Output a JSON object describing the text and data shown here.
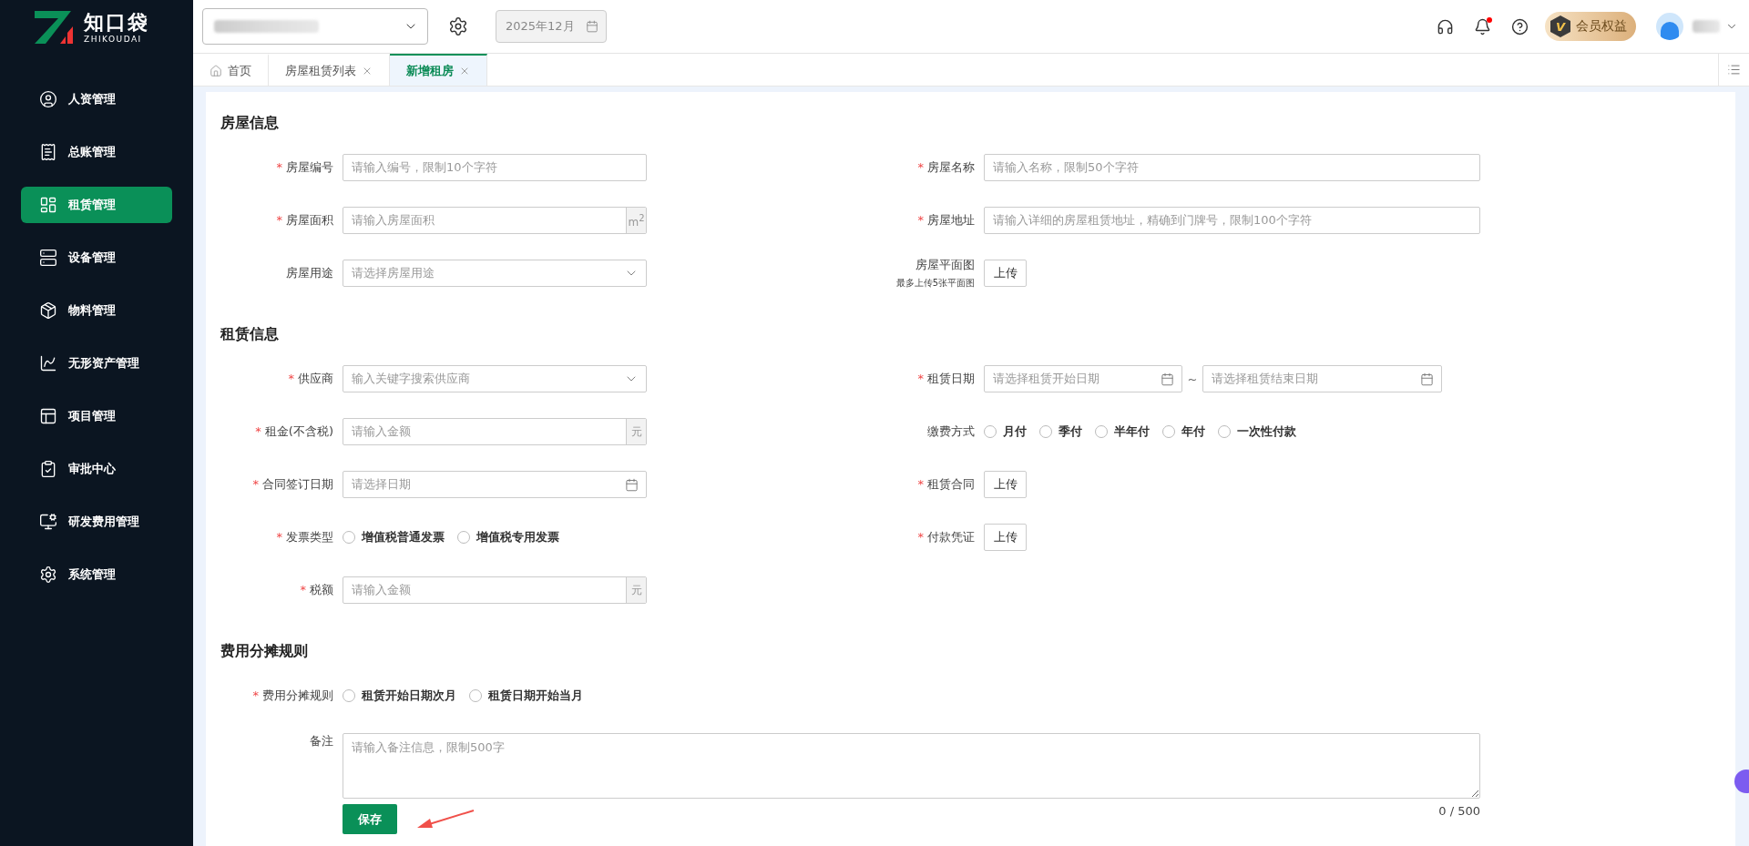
{
  "sidebar": {
    "logo": {
      "name": "知口袋",
      "subtitle": "ZHIKOUDAI"
    },
    "items": [
      {
        "label": "人资管理",
        "selected": false
      },
      {
        "label": "总账管理",
        "selected": false
      },
      {
        "label": "租赁管理",
        "selected": true
      },
      {
        "label": "设备管理",
        "selected": false
      },
      {
        "label": "物料管理",
        "selected": false
      },
      {
        "label": "无形资产管理",
        "selected": false
      },
      {
        "label": "项目管理",
        "selected": false
      },
      {
        "label": "审批中心",
        "selected": false
      },
      {
        "label": "研发费用管理",
        "selected": false
      },
      {
        "label": "系统管理",
        "selected": false
      }
    ]
  },
  "header": {
    "date_field": {
      "value": "2025年12月",
      "disabled": true
    },
    "notification_dot": true,
    "member_badge": {
      "letter": "V",
      "label": "会员权益"
    }
  },
  "tabs": [
    {
      "label": "首页",
      "selected": false,
      "closable": false
    },
    {
      "label": "房屋租赁列表",
      "selected": false,
      "closable": true
    },
    {
      "label": "新增租房",
      "selected": true,
      "closable": true
    }
  ],
  "sections": [
    {
      "title": "房屋信息",
      "rows": [
        [
          {
            "kind": "input",
            "label": "房屋编号",
            "required": true,
            "placeholder": "请输入编号，限制10个字符"
          },
          {
            "kind": "input",
            "label": "房屋名称",
            "required": true,
            "placeholder": "请输入名称，限制50个字符"
          }
        ],
        [
          {
            "kind": "suffix",
            "label": "房屋面积",
            "required": true,
            "placeholder": "请输入房屋面积",
            "suffix": "m$^{2}$"
          },
          {
            "kind": "input",
            "label": "房屋地址",
            "required": true,
            "placeholder": "请输入详细的房屋租赁地址，精确到门牌号，限制100个字符"
          }
        ],
        [
          {
            "kind": "select",
            "label": "房屋用途",
            "required": false,
            "placeholder": "请选择房屋用途"
          },
          {
            "kind": "upload",
            "label": "房屋平面图",
            "required": false,
            "button": "上传",
            "hint": "最多上传5张平面图"
          }
        ]
      ]
    },
    {
      "title": "租赁信息",
      "rows": [
        [
          {
            "kind": "select",
            "label": "供应商",
            "required": true,
            "placeholder": "输入关键字搜索供应商"
          },
          {
            "kind": "daterange",
            "label": "租赁日期",
            "required": true,
            "placeholder": "请选择租赁开始日期",
            "separator": "~",
            "placeholder_end": "请选择租赁结束日期"
          }
        ],
        [
          {
            "kind": "suffix",
            "label": "租金(不含税)",
            "required": true,
            "placeholder": "请输入金额",
            "suffix": "元"
          },
          {
            "kind": "radio",
            "label": "缴费方式",
            "required": false,
            "options": [
              {
                "label": "月付",
                "selected": false
              },
              {
                "label": "季付",
                "selected": false
              },
              {
                "label": "半年付",
                "selected": false
              },
              {
                "label": "年付",
                "selected": false
              },
              {
                "label": "一次性付款",
                "selected": false
              }
            ]
          }
        ],
        [
          {
            "kind": "date",
            "label": "合同签订日期",
            "required": true,
            "placeholder": "请选择日期"
          },
          {
            "kind": "upload",
            "label": "租赁合同",
            "required": true,
            "button": "上传"
          }
        ],
        [
          {
            "kind": "radio",
            "label": "发票类型",
            "required": true,
            "options": [
              {
                "label": "增值税普通发票",
                "selected": false
              },
              {
                "label": "增值税专用发票",
                "selected": false
              }
            ]
          },
          {
            "kind": "upload",
            "label": "付款凭证",
            "required": true,
            "button": "上传"
          }
        ],
        [
          {
            "kind": "suffix",
            "label": "税额",
            "required": true,
            "placeholder": "请输入金额",
            "suffix": "元"
          }
        ]
      ]
    },
    {
      "title": "费用分摊规则",
      "rows": [
        [
          {
            "kind": "radio",
            "label": "费用分摊规则",
            "required": true,
            "options": [
              {
                "label": "租赁开始日期次月",
                "selected": false
              },
              {
                "label": "租赁日期开始当月",
                "selected": false
              }
            ]
          }
        ]
      ]
    }
  ],
  "remark": {
    "label": "备注",
    "placeholder": "请输入备注信息，限制500字",
    "counter": "0 / 500"
  },
  "save_button": "保存",
  "required_mark": "*"
}
